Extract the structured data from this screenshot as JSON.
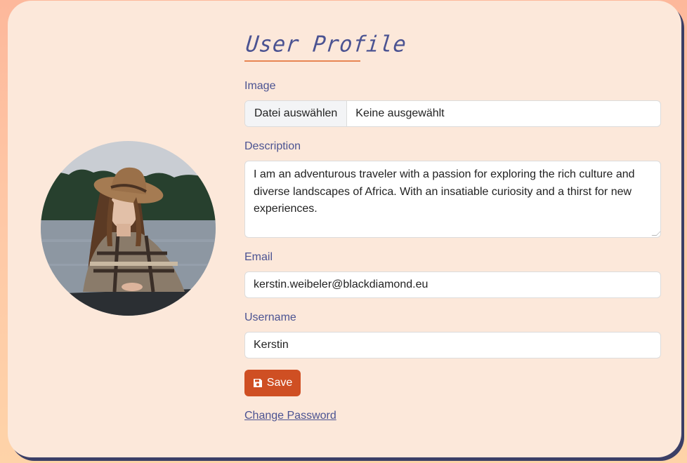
{
  "page": {
    "title": "User Profile"
  },
  "form": {
    "image": {
      "label": "Image",
      "button_label": "Datei auswählen",
      "status": "Keine ausgewählt"
    },
    "description": {
      "label": "Description",
      "value": "I am an adventurous traveler with a passion for exploring the rich culture and diverse landscapes of Africa. With an insatiable curiosity and a thirst for new experiences."
    },
    "email": {
      "label": "Email",
      "value": "kerstin.weibeler@blackdiamond.eu"
    },
    "username": {
      "label": "Username",
      "value": "Kerstin"
    },
    "save_label": "Save",
    "change_password_label": "Change Password"
  },
  "icons": {
    "save": "floppy-disk-icon"
  },
  "colors": {
    "accent": "#cf4f23",
    "label": "#4b5392",
    "card_bg": "#fce8da",
    "title_underline": "#e88652"
  }
}
